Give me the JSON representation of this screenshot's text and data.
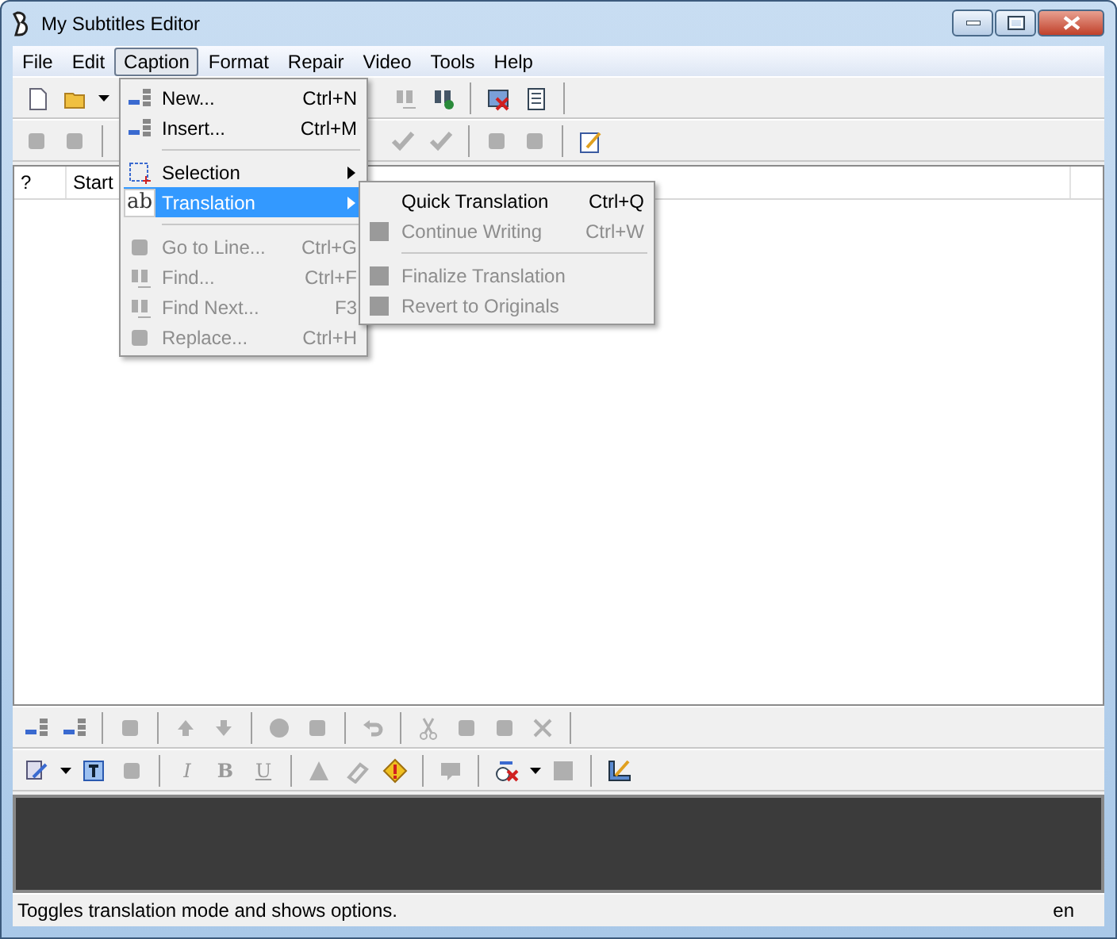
{
  "window": {
    "title": "My Subtitles Editor"
  },
  "menubar": [
    {
      "label": "File",
      "selected": false
    },
    {
      "label": "Edit",
      "selected": false
    },
    {
      "label": "Caption",
      "selected": true
    },
    {
      "label": "Format",
      "selected": false
    },
    {
      "label": "Repair",
      "selected": false
    },
    {
      "label": "Video",
      "selected": false
    },
    {
      "label": "Tools",
      "selected": false
    },
    {
      "label": "Help",
      "selected": false
    }
  ],
  "toolbar_top": [
    {
      "kind": "button",
      "disabled": false
    },
    {
      "kind": "button",
      "disabled": false
    },
    {
      "kind": "dropdown",
      "disabled": false
    },
    {
      "kind": "gap"
    },
    {
      "kind": "button",
      "disabled": true
    },
    {
      "kind": "button",
      "disabled": false
    },
    {
      "kind": "separator"
    },
    {
      "kind": "button",
      "disabled": false
    },
    {
      "kind": "button",
      "disabled": false
    },
    {
      "kind": "separator"
    }
  ],
  "toolbar_second": [
    {
      "kind": "button",
      "disabled": true
    },
    {
      "kind": "button",
      "disabled": true
    },
    {
      "kind": "separator"
    },
    {
      "kind": "gap"
    },
    {
      "kind": "button",
      "disabled": true
    },
    {
      "kind": "button",
      "disabled": true
    },
    {
      "kind": "separator"
    },
    {
      "kind": "button",
      "disabled": true
    },
    {
      "kind": "button",
      "disabled": true
    },
    {
      "kind": "separator"
    },
    {
      "kind": "button",
      "disabled": false
    }
  ],
  "table": {
    "columns": [
      "?",
      "Start"
    ]
  },
  "toolbar_edit": [
    {
      "kind": "button",
      "disabled": false
    },
    {
      "kind": "button",
      "disabled": false
    },
    {
      "kind": "separator"
    },
    {
      "kind": "button",
      "disabled": true
    },
    {
      "kind": "separator"
    },
    {
      "kind": "button",
      "disabled": true
    },
    {
      "kind": "button",
      "disabled": true
    },
    {
      "kind": "separator"
    },
    {
      "kind": "button",
      "disabled": true
    },
    {
      "kind": "button",
      "disabled": true
    },
    {
      "kind": "separator"
    },
    {
      "kind": "button",
      "disabled": true
    },
    {
      "kind": "separator"
    },
    {
      "kind": "button",
      "disabled": true
    },
    {
      "kind": "button",
      "disabled": true
    },
    {
      "kind": "button",
      "disabled": true
    },
    {
      "kind": "button",
      "disabled": true
    },
    {
      "kind": "separator"
    }
  ],
  "toolbar_format": [
    {
      "kind": "button",
      "disabled": false
    },
    {
      "kind": "dropdown",
      "disabled": false
    },
    {
      "kind": "button",
      "disabled": false
    },
    {
      "kind": "button",
      "disabled": true
    },
    {
      "kind": "separator"
    },
    {
      "kind": "letter",
      "label": "I",
      "disabled": true
    },
    {
      "kind": "letter",
      "label": "B",
      "disabled": true
    },
    {
      "kind": "letter",
      "label": "U",
      "disabled": true
    },
    {
      "kind": "separator"
    },
    {
      "kind": "button",
      "disabled": true
    },
    {
      "kind": "button",
      "disabled": true
    },
    {
      "kind": "button",
      "disabled": false
    },
    {
      "kind": "separator"
    },
    {
      "kind": "button",
      "disabled": true
    },
    {
      "kind": "separator"
    },
    {
      "kind": "button",
      "disabled": false
    },
    {
      "kind": "dropdown",
      "disabled": false
    },
    {
      "kind": "button",
      "disabled": true
    },
    {
      "kind": "separator"
    },
    {
      "kind": "button",
      "disabled": false
    }
  ],
  "caption_menu": [
    {
      "kind": "item",
      "label": "New...",
      "shortcut": "Ctrl+N",
      "disabled": false,
      "submenu": false,
      "selected": false
    },
    {
      "kind": "item",
      "label": "Insert...",
      "shortcut": "Ctrl+M",
      "disabled": false,
      "submenu": false,
      "selected": false
    },
    {
      "kind": "separator"
    },
    {
      "kind": "item",
      "label": "Selection",
      "disabled": false,
      "submenu": true,
      "selected": false
    },
    {
      "kind": "item",
      "label": "Translation",
      "icon_text": "ab",
      "disabled": false,
      "submenu": true,
      "selected": true
    },
    {
      "kind": "separator"
    },
    {
      "kind": "item",
      "label": "Go to Line...",
      "shortcut": "Ctrl+G",
      "disabled": true,
      "submenu": false,
      "selected": false
    },
    {
      "kind": "item",
      "label": "Find...",
      "shortcut": "Ctrl+F",
      "disabled": true,
      "submenu": false,
      "selected": false
    },
    {
      "kind": "item",
      "label": "Find Next...",
      "shortcut": "F3",
      "disabled": true,
      "submenu": false,
      "selected": false
    },
    {
      "kind": "item",
      "label": "Replace...",
      "shortcut": "Ctrl+H",
      "disabled": true,
      "submenu": false,
      "selected": false
    }
  ],
  "translation_menu": [
    {
      "kind": "item",
      "label": "Quick Translation",
      "shortcut": "Ctrl+Q",
      "disabled": false
    },
    {
      "kind": "item",
      "label": "Continue Writing",
      "shortcut": "Ctrl+W",
      "disabled": true
    },
    {
      "kind": "separator"
    },
    {
      "kind": "item",
      "label": "Finalize Translation",
      "disabled": true
    },
    {
      "kind": "item",
      "label": "Revert to Originals",
      "disabled": true
    }
  ],
  "status_bar": {
    "message": "Toggles translation mode and shows options.",
    "language": "en"
  }
}
